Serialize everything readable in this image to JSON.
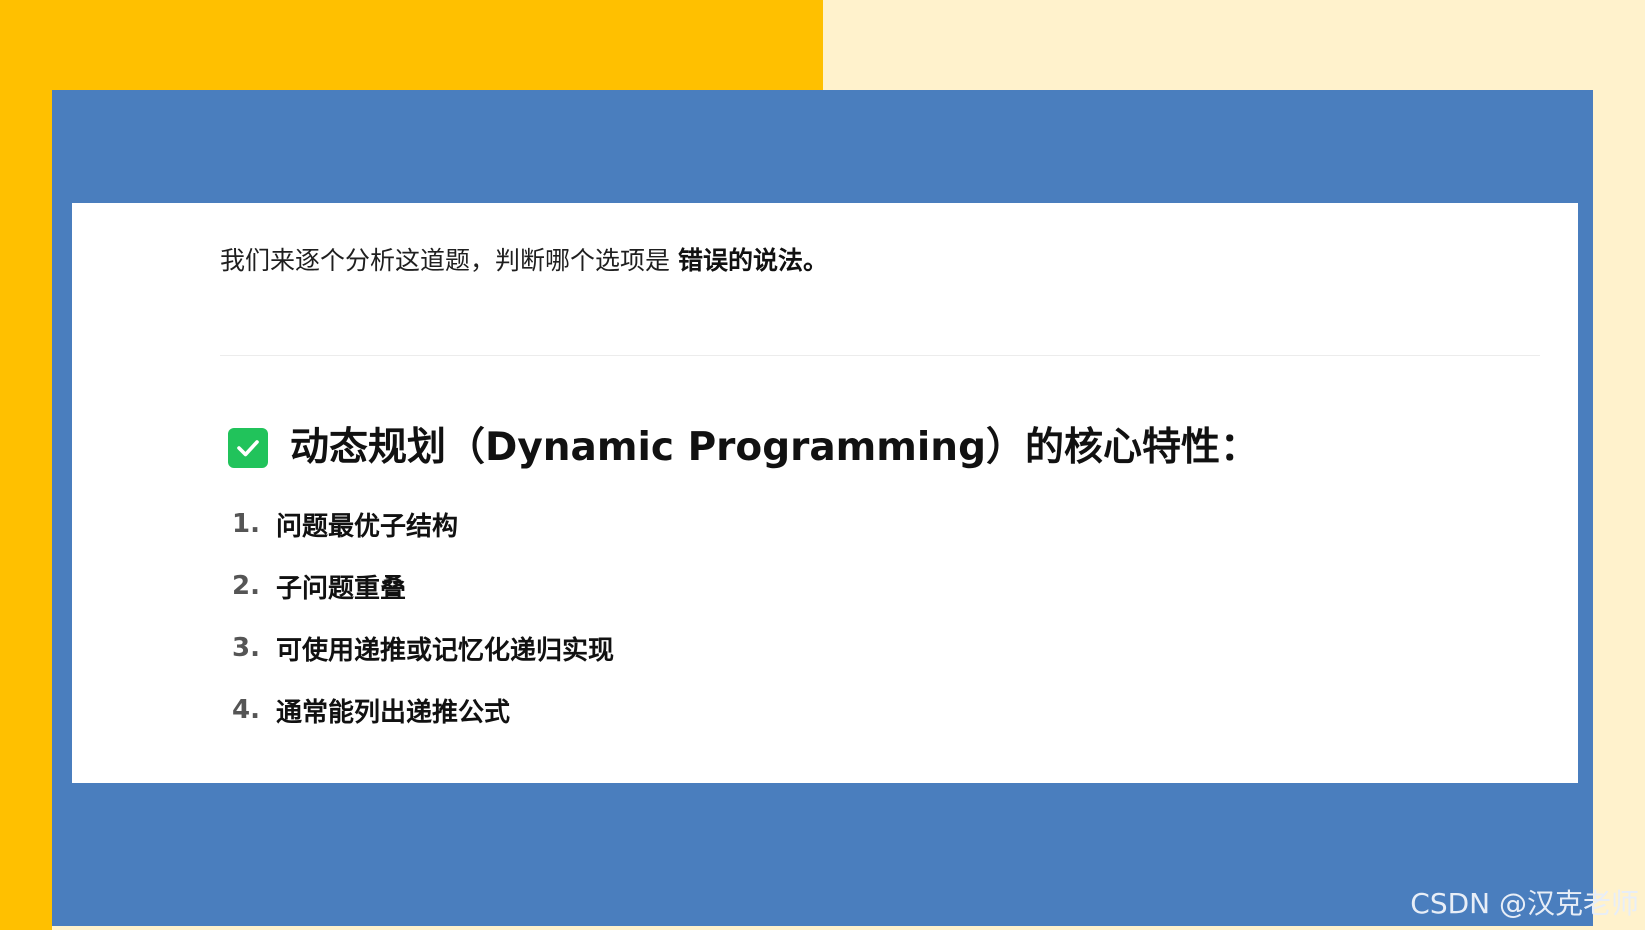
{
  "intro": {
    "text": "我们来逐个分析这道题，判断哪个选项是",
    "emphasis": "错误的说法。"
  },
  "heading": {
    "icon": "check-icon",
    "text": "动态规划（Dynamic Programming）的核心特性："
  },
  "properties": [
    {
      "num": "1.",
      "text": "问题最优子结构"
    },
    {
      "num": "2.",
      "text": "子问题重叠"
    },
    {
      "num": "3.",
      "text": "可使用递推或记忆化递归实现"
    },
    {
      "num": "4.",
      "text": "通常能列出递推公式"
    }
  ],
  "watermark": "CSDN @汉克老师",
  "colors": {
    "yellow": "#ffc000",
    "cream": "#fff2cc",
    "blue": "#4a7ebe",
    "check_green": "#21c35b"
  }
}
